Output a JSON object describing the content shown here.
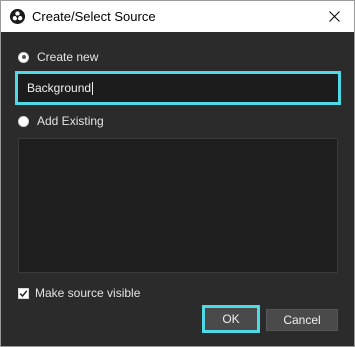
{
  "window": {
    "title": "Create/Select Source",
    "app_icon": "obs-logo-icon",
    "close_icon": "close-icon"
  },
  "options": {
    "create_new_label": "Create new",
    "create_new_selected": true,
    "add_existing_label": "Add Existing",
    "add_existing_selected": false
  },
  "name_input": {
    "value": "Background"
  },
  "existing_sources": [],
  "make_visible": {
    "label": "Make source visible",
    "checked": true
  },
  "buttons": {
    "ok_label": "OK",
    "cancel_label": "Cancel"
  },
  "colors": {
    "background": "#2b2b2b",
    "focus_highlight": "#4fd8e5",
    "list_background": "#1e1e1e",
    "button_background": "#4a4a4a"
  }
}
